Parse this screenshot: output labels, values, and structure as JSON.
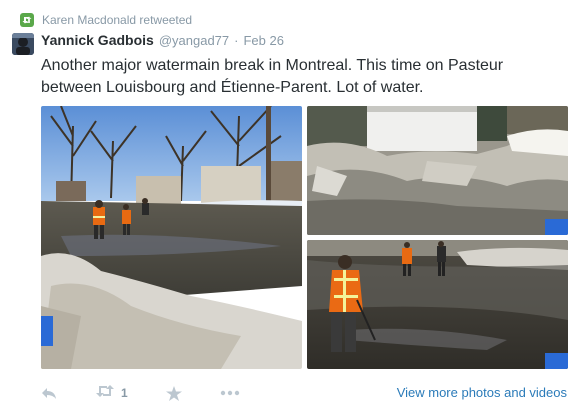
{
  "retweet_context": {
    "icon": "retweet-icon",
    "text": "Karen Macdonald retweeted"
  },
  "tweet": {
    "author_name": "Yannick Gadbois",
    "author_handle": "@yangad77",
    "separator": "·",
    "date": "Feb 26",
    "text": "Another major watermain break in Montreal. This time on Pasteur between Louisbourg and Étienne-Parent. Lot of water."
  },
  "photos": [
    {
      "icon": "photo-1",
      "alt": ""
    },
    {
      "icon": "photo-2",
      "alt": ""
    },
    {
      "icon": "photo-3",
      "alt": ""
    }
  ],
  "actions": {
    "reply_icon": "reply-icon",
    "retweet_icon": "retweet-icon",
    "retweet_count": "1",
    "favorite_icon": "star-icon",
    "more_icon": "more-icon",
    "view_more_label": "View more photos and videos"
  },
  "colors": {
    "retweet_green": "#5aa84a",
    "meta_gray": "#8899a6",
    "link_blue": "#2b7bb9",
    "text": "#292f33"
  }
}
